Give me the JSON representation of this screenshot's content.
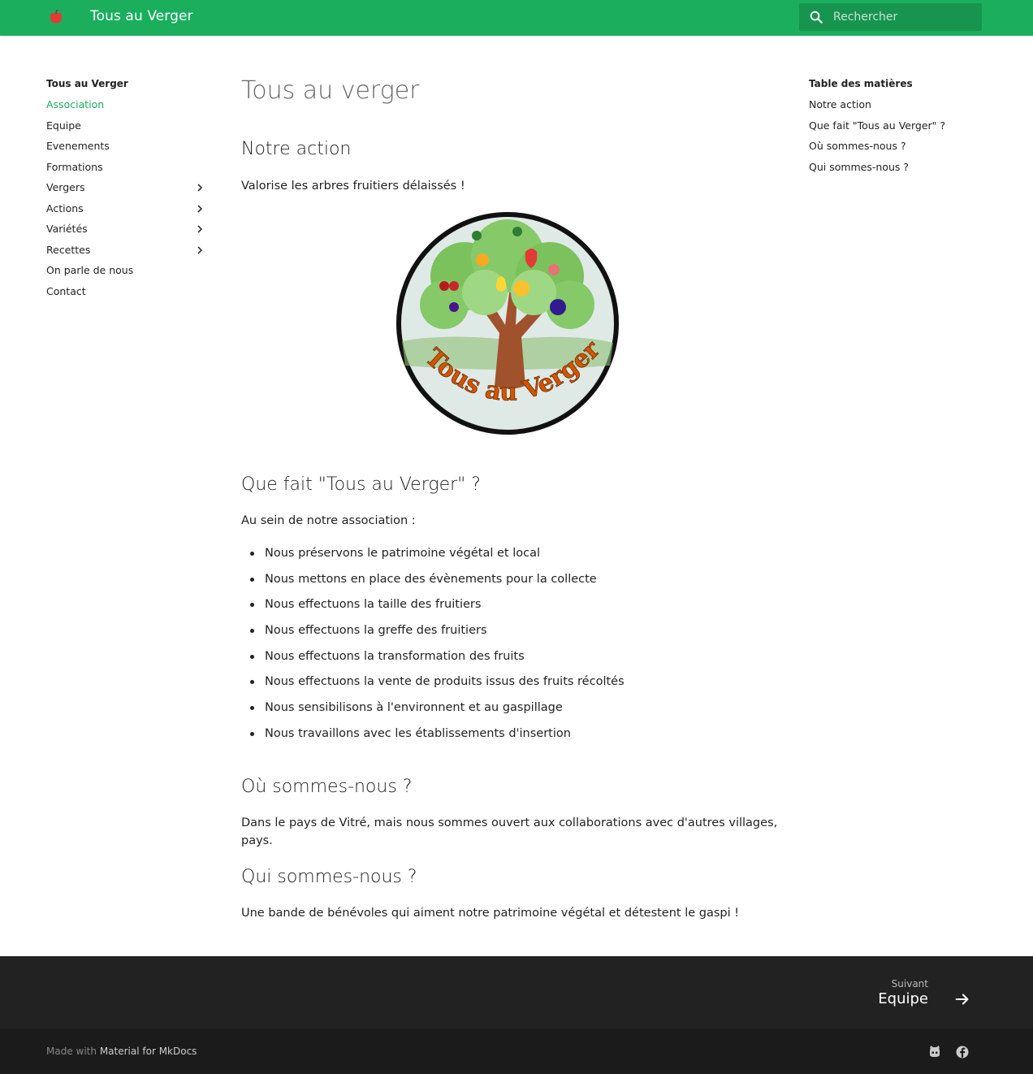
{
  "header": {
    "site_title": "Tous au Verger",
    "search_placeholder": "Rechercher"
  },
  "nav": {
    "title": "Tous au Verger",
    "items": [
      {
        "label": "Association",
        "active": true,
        "expandable": false
      },
      {
        "label": "Equipe",
        "active": false,
        "expandable": false
      },
      {
        "label": "Evenements",
        "active": false,
        "expandable": false
      },
      {
        "label": "Formations",
        "active": false,
        "expandable": false
      },
      {
        "label": "Vergers",
        "active": false,
        "expandable": true
      },
      {
        "label": "Actions",
        "active": false,
        "expandable": true
      },
      {
        "label": "Variétés",
        "active": false,
        "expandable": true
      },
      {
        "label": "Recettes",
        "active": false,
        "expandable": true
      },
      {
        "label": "On parle de nous",
        "active": false,
        "expandable": false
      },
      {
        "label": "Contact",
        "active": false,
        "expandable": false
      }
    ]
  },
  "toc": {
    "title": "Table des matières",
    "items": [
      "Notre action",
      "Que fait \"Tous au Verger\" ?",
      "Où sommes-nous ?",
      "Qui sommes-nous ?"
    ]
  },
  "content": {
    "page_title": "Tous au verger",
    "section1_title": "Notre action",
    "section1_text": "Valorise les arbres fruitiers délaissés !",
    "section2_title": "Que fait \"Tous au Verger\" ?",
    "section2_intro": "Au sein de notre association :",
    "section2_list": [
      "Nous préservons le patrimoine végétal et local",
      "Nous mettons en place des évènements pour la collecte",
      "Nous effectuons la taille des fruitiers",
      "Nous effectuons la greffe des fruitiers",
      "Nous effectuons la transformation des fruits",
      "Nous effectuons la vente de produits issus des fruits récoltés",
      "Nous sensibilisons à l'environnent et au gaspillage",
      "Nous travaillons avec les établissements d'insertion"
    ],
    "section3_title": "Où sommes-nous ?",
    "section3_text": "Dans le pays de Vitré, mais nous sommes ouvert aux collaborations avec d'autres villages, pays.",
    "section4_title": "Qui sommes-nous ?",
    "section4_text": "Une bande de bénévoles qui aiment notre patrimoine végétal et détestent le gaspi !",
    "logo_lettering": "Tous au Verger !"
  },
  "footer": {
    "next_caption": "Suivant",
    "next_title": "Equipe",
    "made_with_prefix": "Made with",
    "made_with_link": "Material for MkDocs",
    "social_icons": [
      "github-icon",
      "facebook-icon"
    ]
  },
  "colors": {
    "primary": "#1aae5d",
    "footer_dark": "#222222",
    "footer_darker": "#1b1b1b"
  }
}
